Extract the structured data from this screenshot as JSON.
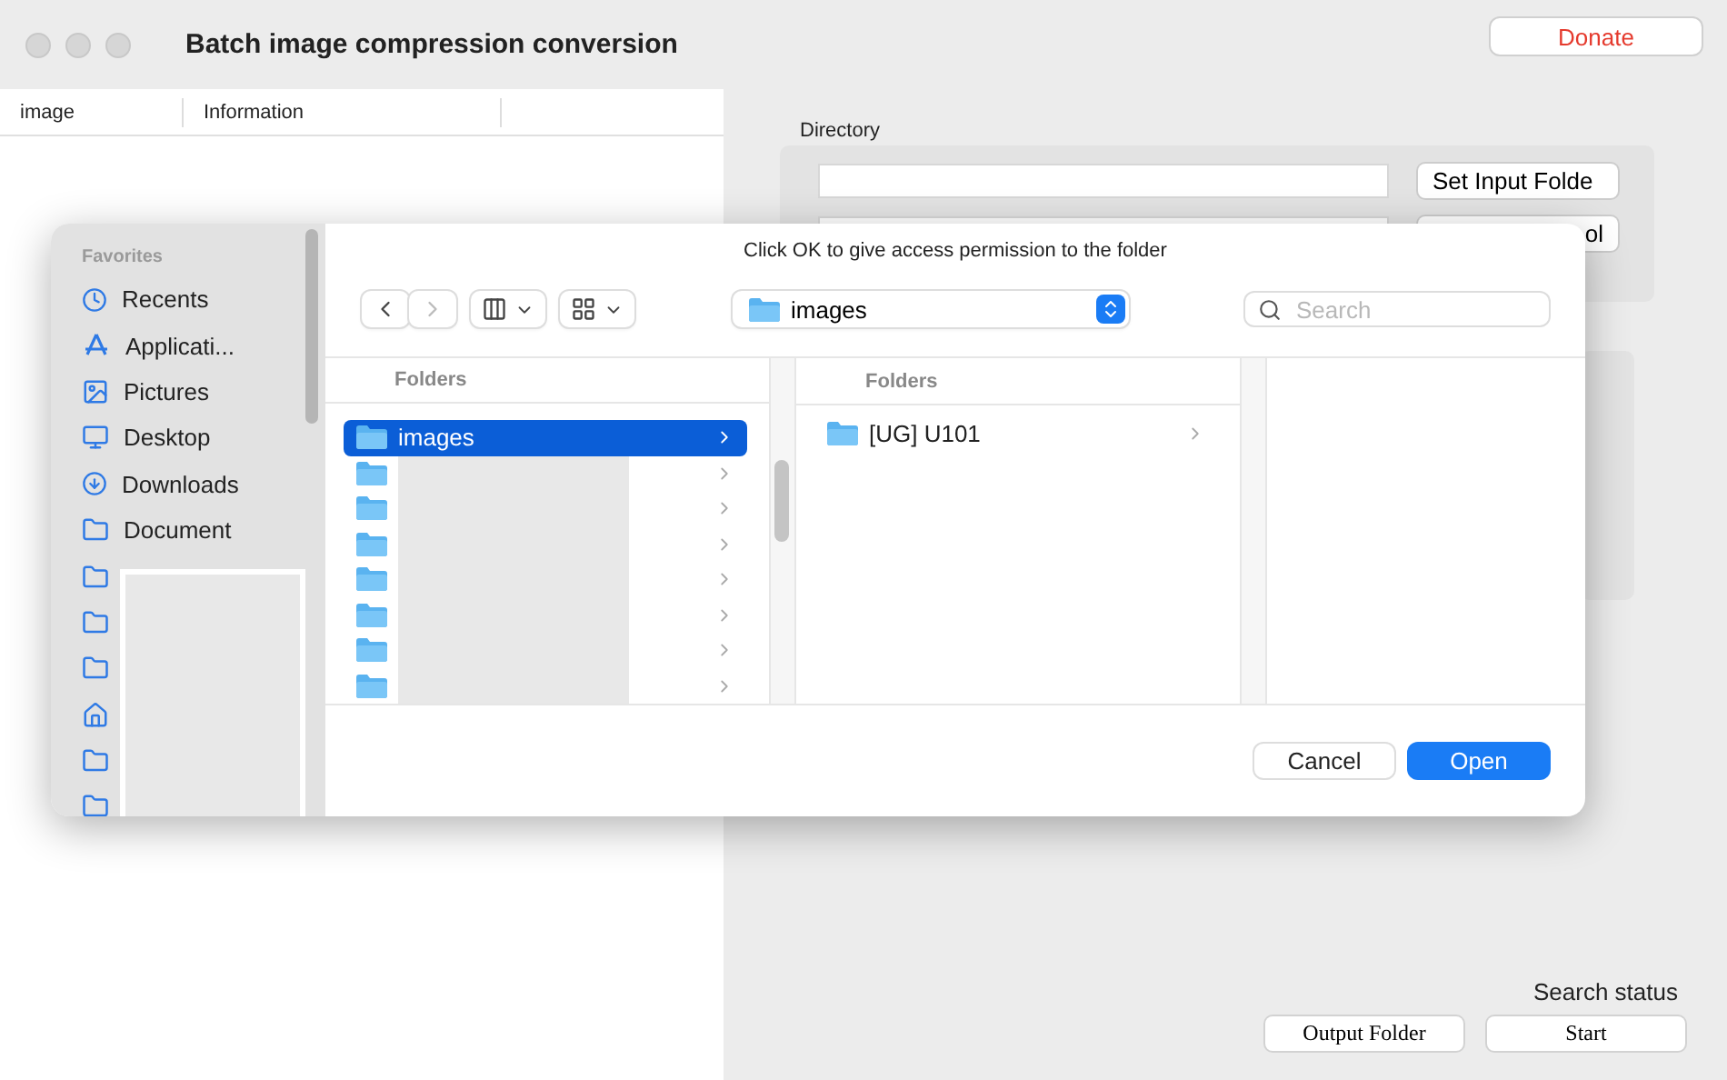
{
  "window": {
    "title": "Batch image compression conversion"
  },
  "donate_button": "Donate",
  "list": {
    "columns": [
      "image",
      "Information"
    ]
  },
  "directory": {
    "label": "Directory",
    "buttons": [
      "Set Input Folde",
      "ol"
    ]
  },
  "search_status": "Search status",
  "bottom_buttons": [
    "Output Folder",
    "Start"
  ],
  "dialog": {
    "message": "Click OK to give access permission to the folder",
    "sidebar": {
      "heading": "Favorites",
      "items": [
        {
          "label": "Recents",
          "kind": "recent"
        },
        {
          "label": "Applicati...",
          "kind": "apps"
        },
        {
          "label": "Pictures",
          "kind": "pictures"
        },
        {
          "label": "Desktop",
          "kind": "desktop"
        },
        {
          "label": "Downloads",
          "kind": "downloads"
        },
        {
          "label": "Document",
          "kind": "folder"
        },
        {
          "kind": "folder"
        },
        {
          "kind": "folder"
        },
        {
          "kind": "folder"
        },
        {
          "kind": "home"
        },
        {
          "kind": "folder"
        },
        {
          "kind": "folder"
        }
      ]
    },
    "location": "images",
    "search": {
      "placeholder": "Search"
    },
    "columns": [
      {
        "heading": "Folders",
        "items": [
          {
            "label": "images",
            "selected": true
          },
          {
            "selected": false
          },
          {
            "selected": false
          },
          {
            "selected": false
          },
          {
            "selected": false
          },
          {
            "selected": false
          },
          {
            "selected": false
          },
          {
            "selected": false
          }
        ]
      },
      {
        "heading": "Folders",
        "items": [
          {
            "label": "[UG] U101",
            "selected": false
          }
        ]
      }
    ],
    "buttons": [
      "Cancel",
      "Open"
    ]
  }
}
